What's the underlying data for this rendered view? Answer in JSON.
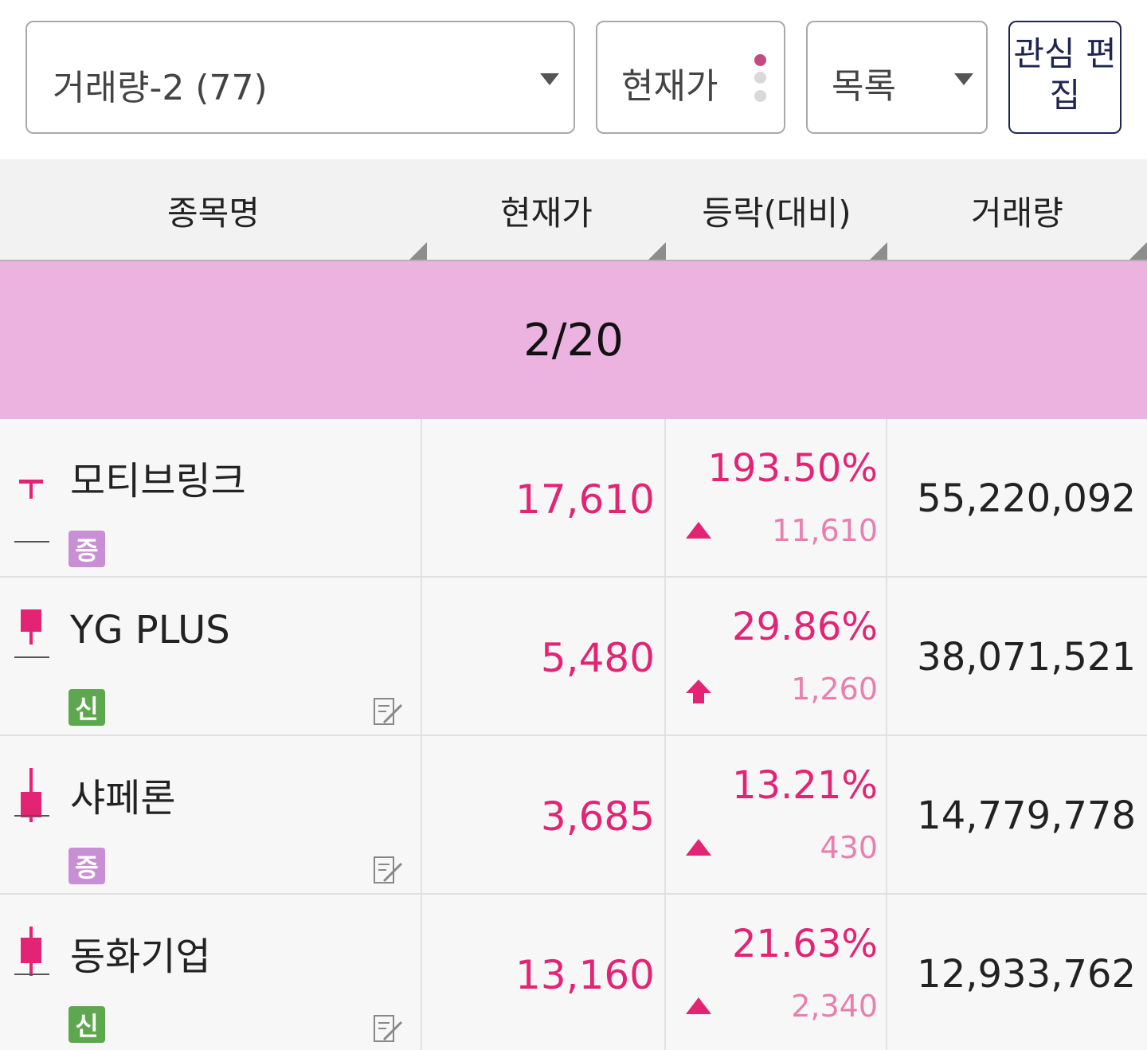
{
  "toolbar": {
    "group_select_value": "거래량-2 (77)",
    "price_toggle_label": "현재가",
    "view_select_value": "목록",
    "edit_button_label": "관심 편집"
  },
  "columns": [
    "종목명",
    "현재가",
    "등락(대비)",
    "거래량"
  ],
  "banner": {
    "label": "2/20"
  },
  "colors": {
    "up": "#e32475",
    "banner": "#ecb3e1",
    "margin_badge": "#c98fd4",
    "credit_badge": "#5da84f"
  },
  "rows": [
    {
      "name": "모티브링크",
      "badge": "증",
      "badge_type": "margin",
      "price": "17,610",
      "change_pct": "193.50%",
      "change_amount": "11,610",
      "change_icon": "up-triangle-icon",
      "volume": "55,220,092",
      "has_memo": false
    },
    {
      "name": "YG PLUS",
      "badge": "신",
      "badge_type": "credit",
      "price": "5,480",
      "change_pct": "29.86%",
      "change_amount": "1,260",
      "change_icon": "upper-limit-arrow-icon",
      "volume": "38,071,521",
      "has_memo": true
    },
    {
      "name": "샤페론",
      "badge": "증",
      "badge_type": "margin",
      "price": "3,685",
      "change_pct": "13.21%",
      "change_amount": "430",
      "change_icon": "up-triangle-icon",
      "volume": "14,779,778",
      "has_memo": true
    },
    {
      "name": "동화기업",
      "badge": "신",
      "badge_type": "credit",
      "price": "13,160",
      "change_pct": "21.63%",
      "change_amount": "2,340",
      "change_icon": "up-triangle-icon",
      "volume": "12,933,762",
      "has_memo": true
    }
  ]
}
